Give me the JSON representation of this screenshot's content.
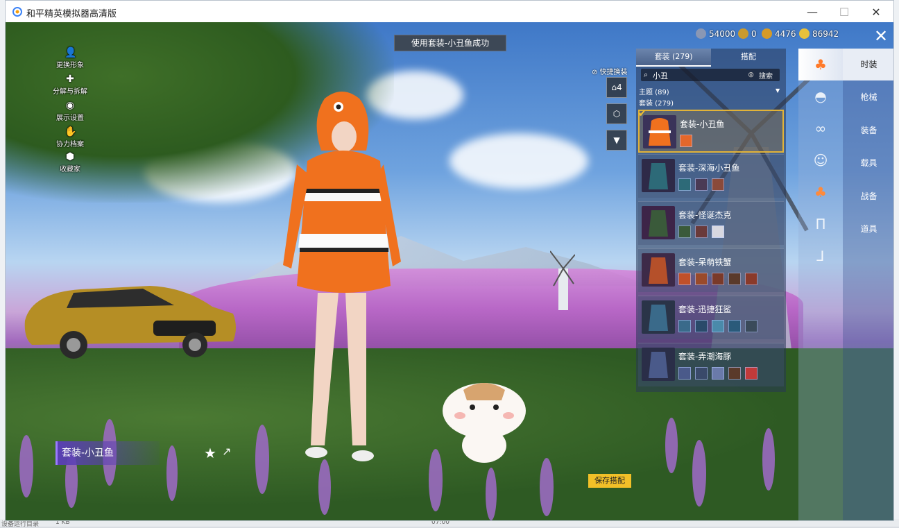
{
  "window": {
    "title": "和平精英模拟器高清版"
  },
  "toast": "使用套装-小丑鱼成功",
  "currencies": [
    {
      "value": "54000",
      "color": "#8a97b4",
      "icon": "silver-coin"
    },
    {
      "value": "0",
      "color": "#c99a2e",
      "icon": "medal-coin"
    },
    {
      "value": "4476",
      "color": "#d59a28",
      "icon": "gold-coin"
    },
    {
      "value": "86942",
      "color": "#e8c13c",
      "icon": "diamond-coin"
    }
  ],
  "left_menu": [
    {
      "label": "更换形象",
      "icon": "person-icon"
    },
    {
      "label": "分解与拆解",
      "icon": "puzzle-icon"
    },
    {
      "label": "展示设置",
      "icon": "eye-icon"
    },
    {
      "label": "协力档案",
      "icon": "hand-icon"
    },
    {
      "label": "收藏家",
      "icon": "badge-icon"
    }
  ],
  "quick_change": {
    "label": "快捷换装",
    "slot_number": "4"
  },
  "panel": {
    "tabs": [
      {
        "label": "套装 (279)"
      },
      {
        "label": "搭配"
      }
    ],
    "search": {
      "value": "小丑",
      "button": "搜索"
    },
    "filters": [
      {
        "label": "主题 (89)"
      },
      {
        "label": "套装 (279)"
      }
    ],
    "outfits": [
      {
        "name": "套装-小丑鱼",
        "selected": true,
        "pieces": 1
      },
      {
        "name": "套装-深海小丑鱼",
        "selected": false,
        "pieces": 3
      },
      {
        "name": "套装-怪诞杰克",
        "selected": false,
        "pieces": 3
      },
      {
        "name": "套装-呆萌铁蟹",
        "selected": false,
        "pieces": 5
      },
      {
        "name": "套装-迅捷狂鲨",
        "selected": false,
        "pieces": 5
      },
      {
        "name": "套装-弄潮海豚",
        "selected": false,
        "pieces": 5
      }
    ]
  },
  "categories": [
    {
      "label": "时装",
      "active": true
    },
    {
      "label": "枪械"
    },
    {
      "label": "装备"
    },
    {
      "label": "载具"
    },
    {
      "label": "战备"
    },
    {
      "label": "道具"
    }
  ],
  "rail_icons": [
    "outfit-icon",
    "hat-icon",
    "glasses-icon",
    "mask-icon",
    "top-icon",
    "pants-icon",
    "shoes-icon"
  ],
  "current_outfit": "套装-小丑鱼",
  "save_button": "保存搭配",
  "desk_bottom": {
    "left_text": "设备运行目录",
    "mid_text": "1 KB",
    "right_text": "07:00"
  }
}
